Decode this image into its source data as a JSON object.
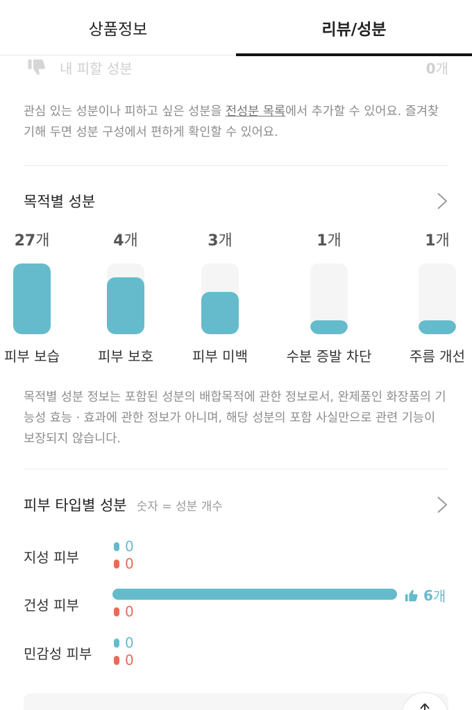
{
  "tabs": [
    {
      "label": "상품정보"
    },
    {
      "label": "리뷰/성분"
    }
  ],
  "avoid": {
    "label": "내 피할 성분",
    "count": "0",
    "unit": "개",
    "icon": "thumb-down-icon"
  },
  "note_top": {
    "before": "관심 있는 성분이나 피하고 싶은 성분을 ",
    "link": "전성분 목록",
    "after": "에서 추가할 수 있어요. 즐겨찾기해 두면 성분 구성에서 편하게 확인할 수 있어요."
  },
  "purpose_section": {
    "title": "목적별 성분"
  },
  "purposes": [
    {
      "count": "27",
      "unit": "개",
      "label": "피부 보습",
      "fill": 1.0
    },
    {
      "count": "4",
      "unit": "개",
      "label": "피부 보호",
      "fill": 0.8
    },
    {
      "count": "3",
      "unit": "개",
      "label": "피부 미백",
      "fill": 0.6
    },
    {
      "count": "1",
      "unit": "개",
      "label": "수분 증발 차단",
      "fill": 0.2
    },
    {
      "count": "1",
      "unit": "개",
      "label": "주름 개선",
      "fill": 0.2
    }
  ],
  "note_purpose": "목적별 성분 정보는 포함된 성분의 배합목적에 관한 정보로서, 완제품인 화장품의 기능성 효능 · 효과에 관한 정보가 아니며, 해당 성분의 포함 사실만으로 관련 기능이 보장되지 않습니다.",
  "skin_section": {
    "title": "피부 타입별 성분",
    "subtitle": "숫자 = 성분 개수"
  },
  "skin_types": [
    {
      "label": "지성 피부",
      "good": "0",
      "bad": "0",
      "good_fill": 0
    },
    {
      "label": "건성 피부",
      "good": "6",
      "good_unit": "개",
      "bad": "0",
      "good_fill": 1.0
    },
    {
      "label": "민감성 피부",
      "good": "0",
      "bad": "0",
      "good_fill": 0
    }
  ],
  "colors": {
    "accent": "#65bbcc",
    "negative": "#e56c58",
    "muted": "#8c8c8c"
  }
}
